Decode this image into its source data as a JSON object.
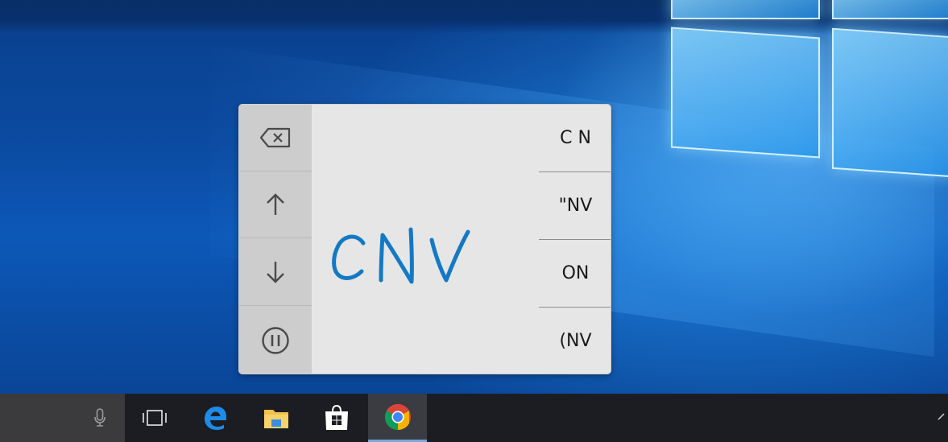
{
  "handwriting_panel": {
    "buttons": [
      {
        "name": "backspace",
        "icon": "backspace-icon"
      },
      {
        "name": "arrow-up",
        "icon": "arrow-up-icon"
      },
      {
        "name": "arrow-down",
        "icon": "arrow-down-icon"
      },
      {
        "name": "pause",
        "icon": "pause-icon"
      }
    ],
    "ink_text": "cNv",
    "ink_color": "#1479c4",
    "suggestions": [
      "C N",
      "\"NV",
      "ON",
      "(NV"
    ]
  },
  "taskbar": {
    "items": [
      {
        "name": "microphone",
        "icon": "microphone-icon"
      },
      {
        "name": "task-view",
        "icon": "task-view-icon"
      },
      {
        "name": "edge",
        "icon": "edge-icon"
      },
      {
        "name": "file-explorer",
        "icon": "folder-icon"
      },
      {
        "name": "store",
        "icon": "store-icon"
      },
      {
        "name": "chrome",
        "icon": "chrome-icon",
        "active": true
      }
    ]
  },
  "colors": {
    "taskbar_bg": "#1b1d22",
    "panel_bg": "#e6e6e6",
    "active_indicator": "#7aa7d8"
  }
}
